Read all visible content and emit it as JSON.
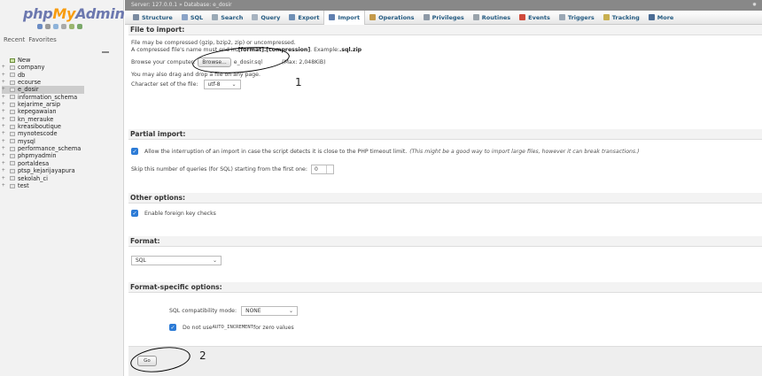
{
  "sidebar": {
    "logo_php": "php",
    "logo_my": "My",
    "logo_admin": "Admin",
    "recent_label": "Recent",
    "favorites_label": "Favorites",
    "databases": [
      {
        "label": "New",
        "toggle": "",
        "kind": "new"
      },
      {
        "label": "company",
        "toggle": "+",
        "kind": "db"
      },
      {
        "label": "db",
        "toggle": "+",
        "kind": "db"
      },
      {
        "label": "ecourse",
        "toggle": "+",
        "kind": "db"
      },
      {
        "label": "e_dosir",
        "toggle": "+",
        "kind": "selected"
      },
      {
        "label": "information_schema",
        "toggle": "+",
        "kind": "db"
      },
      {
        "label": "kejarime_arsip",
        "toggle": "+",
        "kind": "db"
      },
      {
        "label": "kepegawaian",
        "toggle": "+",
        "kind": "db"
      },
      {
        "label": "kn_merauke",
        "toggle": "+",
        "kind": "db"
      },
      {
        "label": "kreasiboutique",
        "toggle": "+",
        "kind": "db"
      },
      {
        "label": "mynotescode",
        "toggle": "+",
        "kind": "db"
      },
      {
        "label": "mysql",
        "toggle": "+",
        "kind": "db"
      },
      {
        "label": "performance_schema",
        "toggle": "+",
        "kind": "db"
      },
      {
        "label": "phpmyadmin",
        "toggle": "+",
        "kind": "db"
      },
      {
        "label": "portaldesa",
        "toggle": "+",
        "kind": "db"
      },
      {
        "label": "ptsp_kejarijayapura",
        "toggle": "+",
        "kind": "db"
      },
      {
        "label": "sekolah_ci",
        "toggle": "+",
        "kind": "db"
      },
      {
        "label": "test",
        "toggle": "+",
        "kind": "db"
      }
    ]
  },
  "topbar": {
    "breadcrumb": "Server: 127.0.0.1 » Database: e_dosir"
  },
  "tabs": [
    {
      "label": "Structure",
      "active": false,
      "color": "#7a8aa0"
    },
    {
      "label": "SQL",
      "active": false,
      "color": "#8aa3c7"
    },
    {
      "label": "Search",
      "active": false,
      "color": "#9aa9b6"
    },
    {
      "label": "Query",
      "active": false,
      "color": "#a7b3c0"
    },
    {
      "label": "Export",
      "active": false,
      "color": "#6e8fb5"
    },
    {
      "label": "Import",
      "active": true,
      "color": "#5f7fb0"
    },
    {
      "label": "Operations",
      "active": false,
      "color": "#c49a4a"
    },
    {
      "label": "Privileges",
      "active": false,
      "color": "#8e9aa7"
    },
    {
      "label": "Routines",
      "active": false,
      "color": "#9aa3ab"
    },
    {
      "label": "Events",
      "active": false,
      "color": "#d04a3b"
    },
    {
      "label": "Triggers",
      "active": false,
      "color": "#9aa7b4"
    },
    {
      "label": "Tracking",
      "active": false,
      "color": "#c9b050"
    },
    {
      "label": "More",
      "active": false,
      "color": "#4a6b94"
    }
  ],
  "file_import": {
    "heading": "File to import:",
    "compress_line1": "File may be compressed (gzip, bzip2, zip) or uncompressed.",
    "compress_line2_pre": "A compressed file's name must end in ",
    "compress_line2_bold": ".[format].[compression]",
    "compress_line2_mid": ". Example: ",
    "compress_line2_example": ".sql.zip",
    "browse_label": "Browse your computer:",
    "browse_button": "Browse...",
    "chosen_file": "e_dosir.sql",
    "max_size": "(Max: 2,048KiB)",
    "drag_hint": "You may also drag and drop a file on any page.",
    "charset_label": "Character set of the file:",
    "charset_value": "utf-8"
  },
  "partial_import": {
    "heading": "Partial import:",
    "interrupt_label": "Allow the interruption of an import in case the script detects it is close to the PHP timeout limit.",
    "interrupt_note": "(This might be a good way to import large files, however it can break transactions.)",
    "interrupt_checked": true,
    "skip_label": "Skip this number of queries (for SQL) starting from the first one:",
    "skip_value": "0"
  },
  "other_options": {
    "heading": "Other options:",
    "foreign_keys_label": "Enable foreign key checks",
    "foreign_keys_checked": true
  },
  "format": {
    "heading": "Format:",
    "value": "SQL"
  },
  "format_specific": {
    "heading": "Format-specific options:",
    "compat_label": "SQL compatibility mode:",
    "compat_value": "NONE",
    "auto_inc_pre": "Do not use ",
    "auto_inc_code": "AUTO_INCREMENT",
    "auto_inc_post": " for zero values",
    "auto_inc_checked": true
  },
  "go_button": "Go",
  "annotations": {
    "one": "1",
    "two": "2"
  }
}
